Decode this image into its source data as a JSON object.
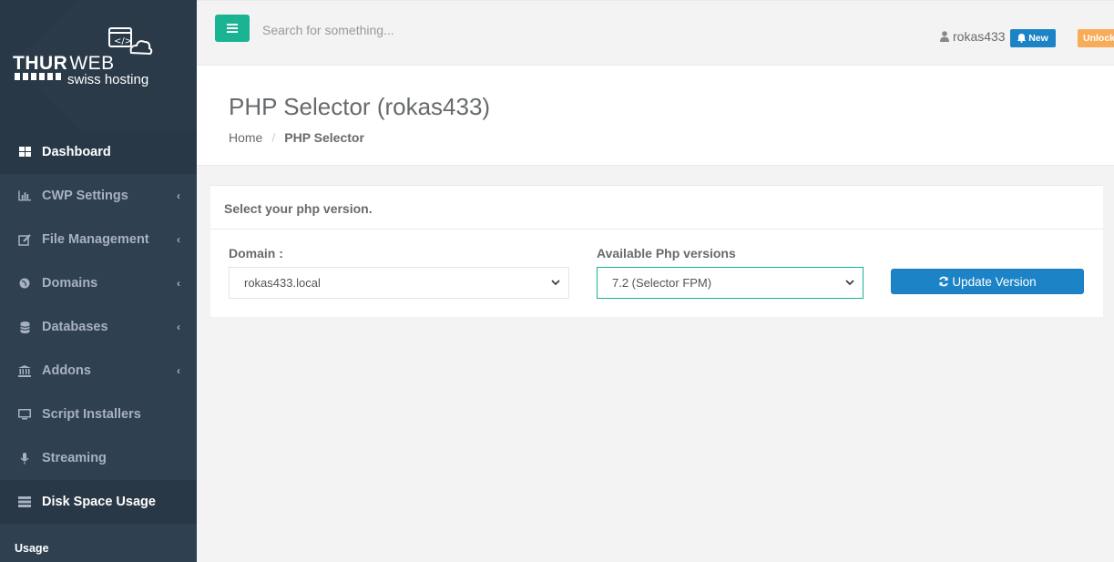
{
  "brand": {
    "name_bold": "THUR",
    "name_light": "WEB",
    "tagline": "swiss hosting"
  },
  "sidebar": {
    "items": [
      {
        "label": "Dashboard",
        "icon": "grid-icon"
      },
      {
        "label": "CWP Settings",
        "icon": "bar-chart-icon"
      },
      {
        "label": "File Management",
        "icon": "edit-icon"
      },
      {
        "label": "Domains",
        "icon": "globe-icon"
      },
      {
        "label": "Databases",
        "icon": "database-icon"
      },
      {
        "label": "Addons",
        "icon": "bank-icon"
      },
      {
        "label": "Script Installers",
        "icon": "monitor-icon"
      },
      {
        "label": "Streaming",
        "icon": "microphone-icon"
      },
      {
        "label": "Disk Space Usage",
        "icon": "server-icon"
      }
    ],
    "footer_label": "Usage"
  },
  "topbar": {
    "search_placeholder": "Search for something...",
    "username": "rokas433",
    "new_badge": "New",
    "unlock_badge": "Unlock"
  },
  "page": {
    "title": "PHP Selector (rokas433)",
    "breadcrumb_home": "Home",
    "breadcrumb_current": "PHP Selector"
  },
  "panel": {
    "title": "Select your php version.",
    "domain_label": "Domain :",
    "domain_value": "rokas433.local",
    "php_label": "Available Php versions",
    "php_value": "7.2 (Selector FPM)",
    "update_button": "Update Version"
  },
  "colors": {
    "sidebar_bg": "#2f4050",
    "accent_green": "#1ab394",
    "primary_blue": "#1c84c6",
    "warning_orange": "#f8ac59"
  }
}
